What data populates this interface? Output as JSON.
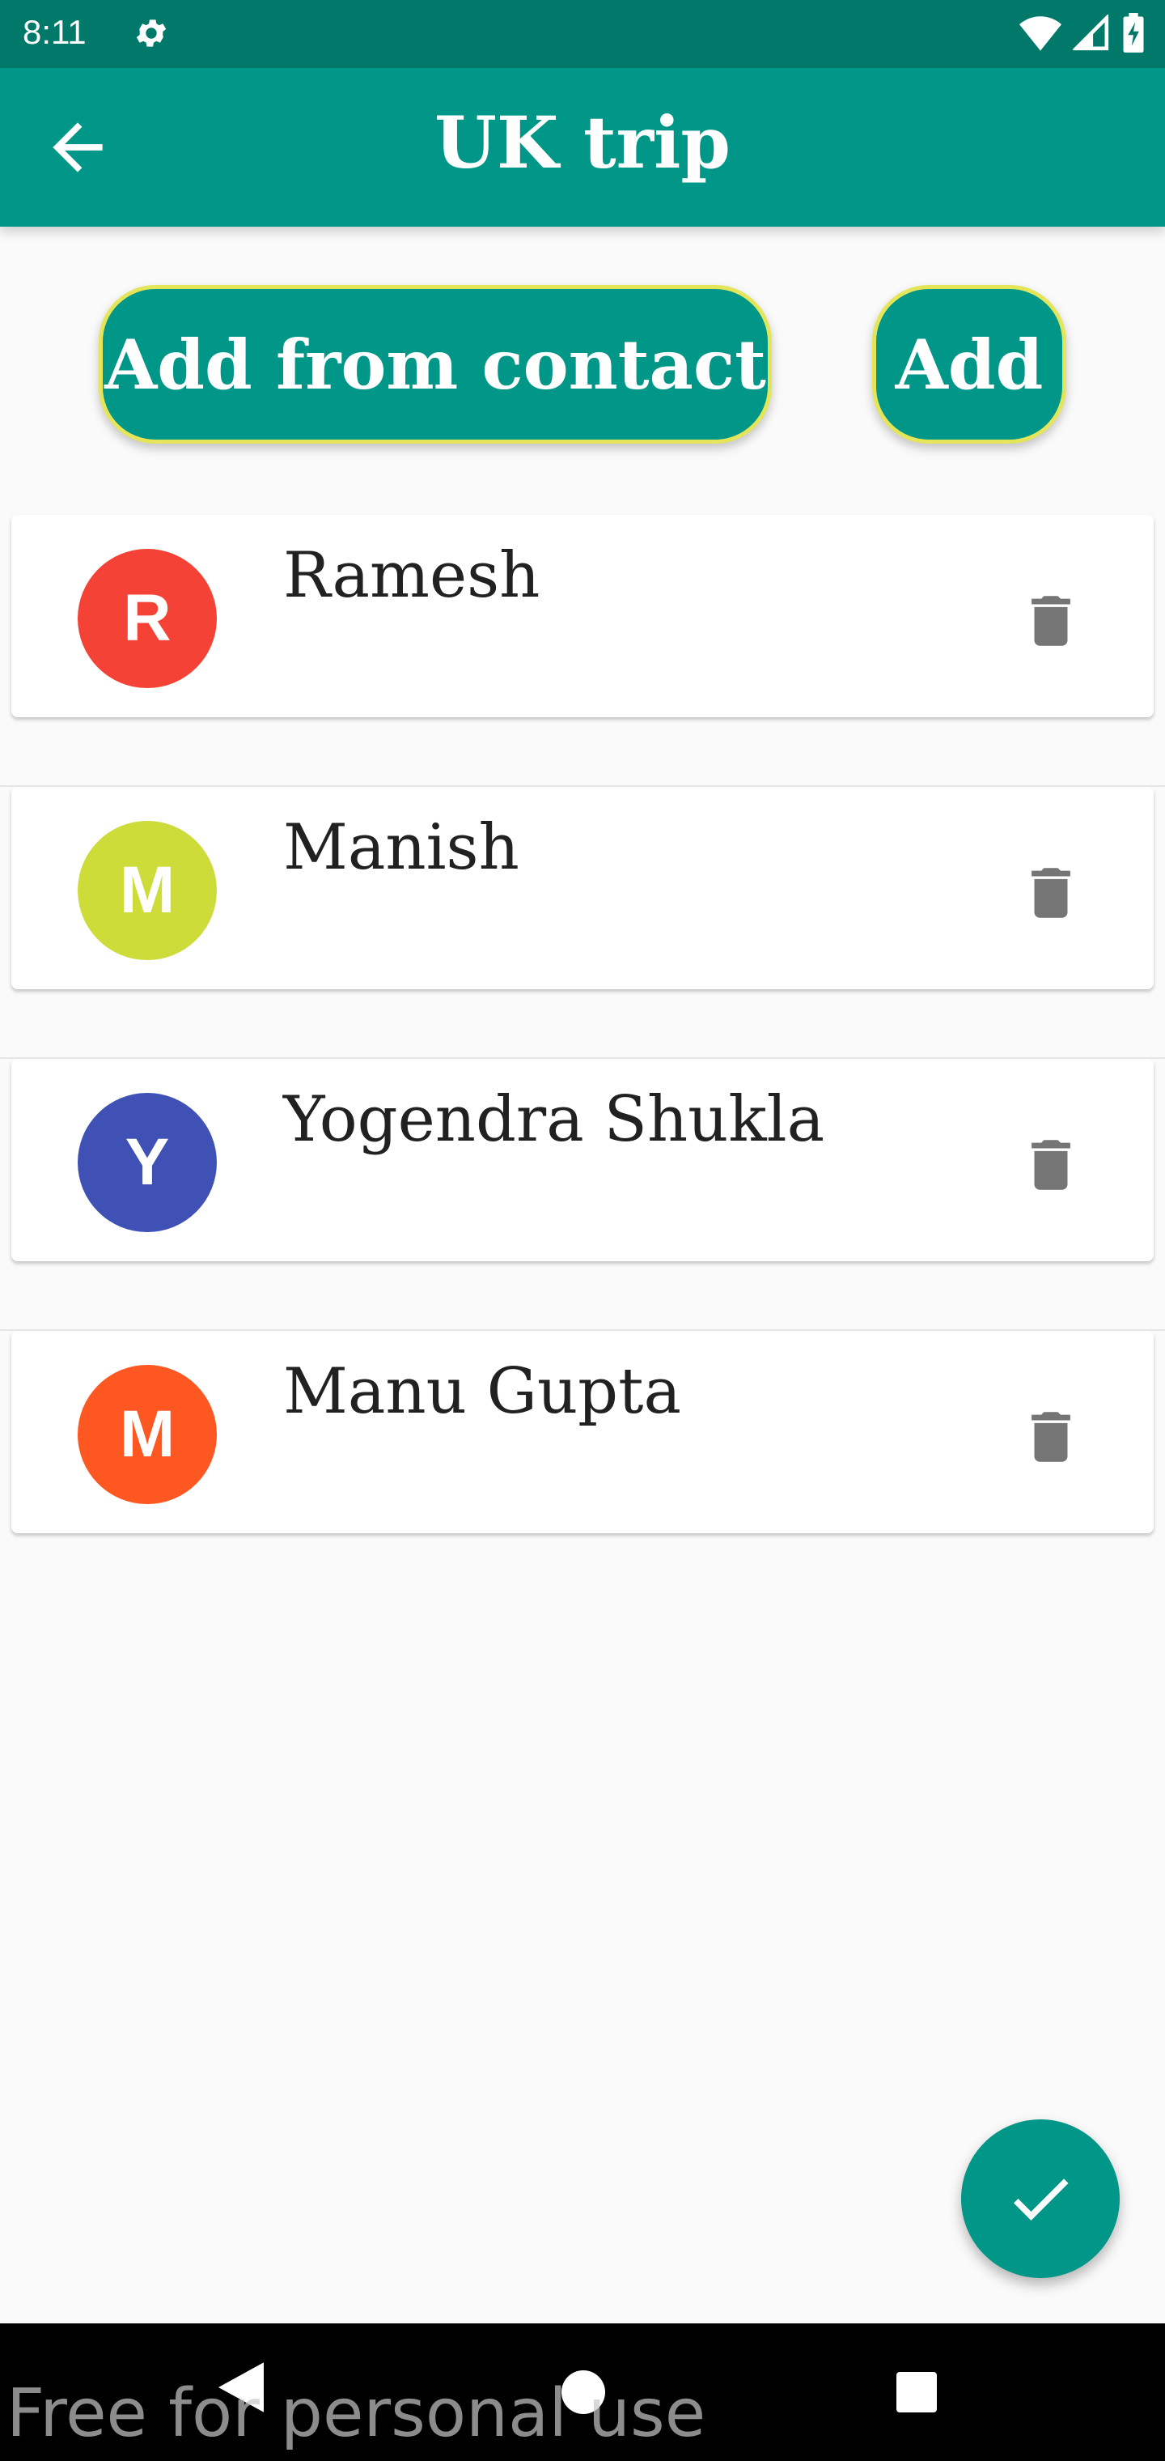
{
  "status_bar": {
    "time": "8:11",
    "icons": [
      "gear-icon",
      "wifi-icon",
      "signal-icon",
      "battery-icon"
    ]
  },
  "app_bar": {
    "title": "UK trip",
    "back_icon": "arrow-left-icon",
    "color": "#009688"
  },
  "actions": {
    "add_from_contact_label": "Add from contact",
    "add_label": "Add"
  },
  "members": [
    {
      "initial": "R",
      "name": "Ramesh",
      "color": "#f44336"
    },
    {
      "initial": "M",
      "name": "Manish",
      "color": "#cddc39"
    },
    {
      "initial": "Y",
      "name": "Yogendra Shukla",
      "color": "#3f51b5"
    },
    {
      "initial": "M",
      "name": "Manu Gupta",
      "color": "#ff5722"
    }
  ],
  "fab": {
    "icon": "checkmark-icon"
  },
  "nav_bar": {
    "icons": [
      "nav-back-icon",
      "nav-home-icon",
      "nav-recents-icon"
    ]
  },
  "watermark": "Free for personal use"
}
